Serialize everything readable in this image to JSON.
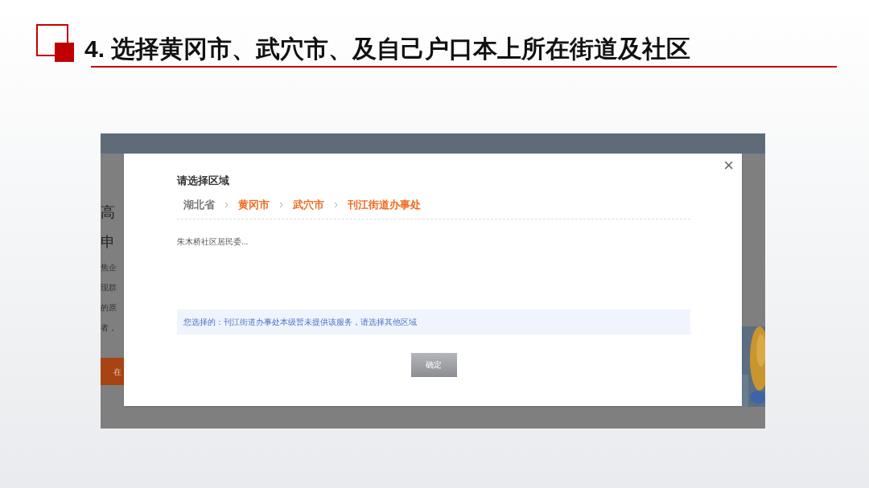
{
  "slide_title": "4. 选择黄冈市、武穴市、及自己户口本上所在街道及社区",
  "background_page": {
    "texts": [
      "高",
      "申",
      "焦企",
      "现群",
      "的原",
      "者，"
    ],
    "button": "在"
  },
  "dialog": {
    "title": "请选择区域",
    "breadcrumb": [
      {
        "label": "湖北省",
        "selected": false
      },
      {
        "label": "黄冈市",
        "selected": true
      },
      {
        "label": "武穴市",
        "selected": true
      },
      {
        "label": "刊江街道办事处",
        "selected": true
      }
    ],
    "options": [
      "朱木桥社区居民委..."
    ],
    "notice": "您选择的：刊江街道办事处本级暂未提供该服务，请选择其他区域",
    "confirm_button": "确定",
    "close": "×"
  }
}
